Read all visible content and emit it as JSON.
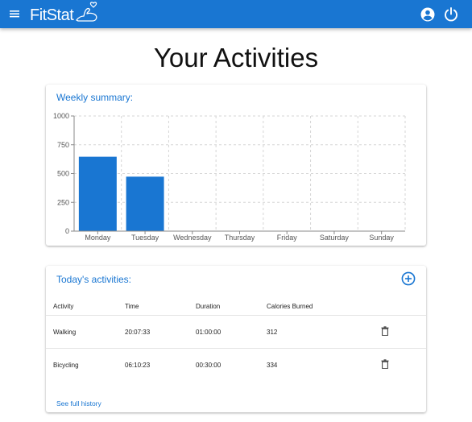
{
  "app": {
    "name": "FitStat",
    "icons": {
      "menu": "menu-icon",
      "logo": "flexed-arm-heart-icon",
      "account": "account-circle-icon",
      "power": "power-icon"
    }
  },
  "page": {
    "title": "Your Activities"
  },
  "summary": {
    "title": "Weekly summary:",
    "accent": "#1976d2"
  },
  "chart_data": {
    "type": "bar",
    "title": "",
    "categories": [
      "Monday",
      "Tuesday",
      "Wednesday",
      "Thursday",
      "Friday",
      "Saturday",
      "Sunday"
    ],
    "values": [
      646,
      473,
      0,
      0,
      0,
      0,
      0
    ],
    "xlabel": "",
    "ylabel": "",
    "ylim": [
      0,
      1000
    ],
    "yticks": [
      "0",
      "250",
      "500",
      "750",
      "1000"
    ],
    "grid": true,
    "bar_color": "#1976d2"
  },
  "today": {
    "title": "Today's activities:",
    "add_icon": "add-circle-icon",
    "columns": [
      "Activity",
      "Time",
      "Duration",
      "Calories Burned"
    ],
    "rows": [
      {
        "activity": "Walking",
        "time": "20:07:33",
        "duration": "01:00:00",
        "calories": "312",
        "delete_icon": "trash-icon"
      },
      {
        "activity": "Bicycling",
        "time": "06:10:23",
        "duration": "00:30:00",
        "calories": "334",
        "delete_icon": "trash-icon"
      }
    ],
    "history_link": "See full history"
  }
}
